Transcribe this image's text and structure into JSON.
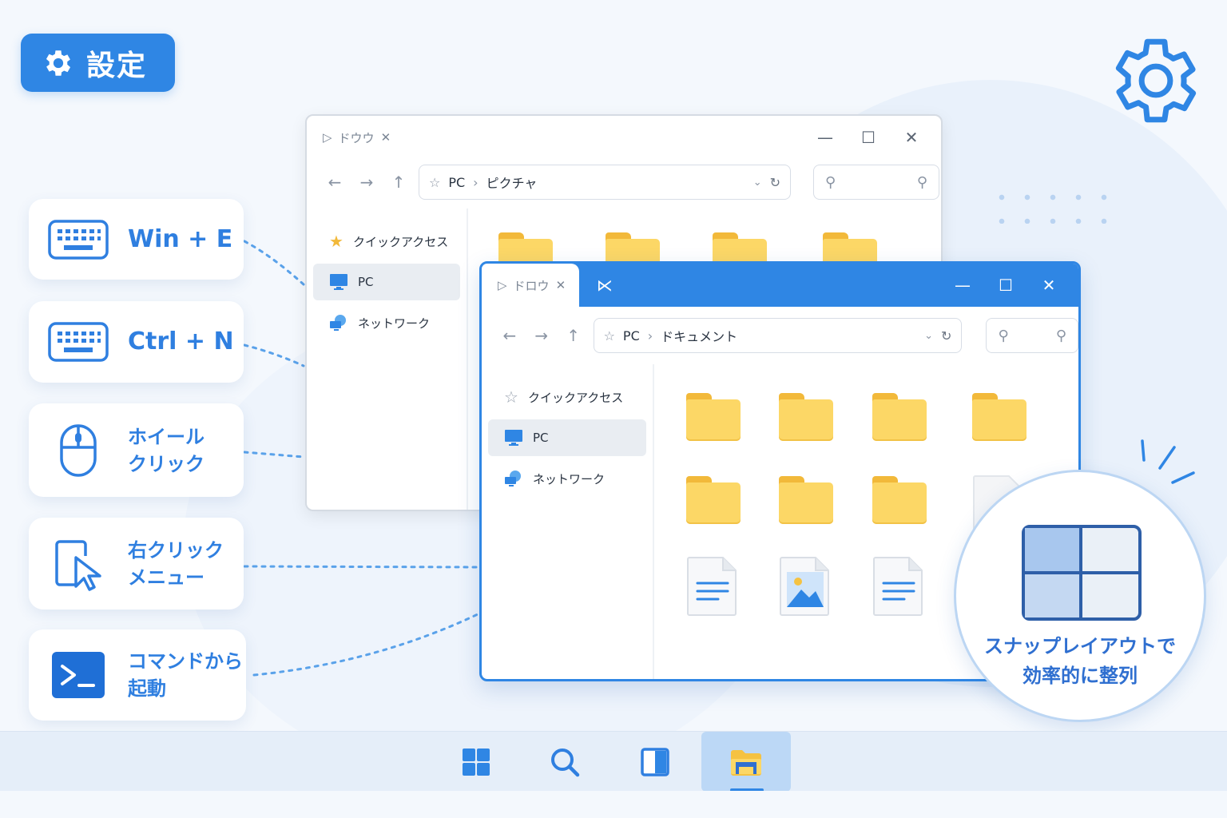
{
  "settings_badge": {
    "label": "設定"
  },
  "shortcuts": [
    {
      "id": "win-e",
      "label": "Win + E",
      "icon": "keyboard-icon"
    },
    {
      "id": "ctrl-n",
      "label": "Ctrl + N",
      "icon": "keyboard-icon"
    },
    {
      "id": "wheel",
      "label": "ホイール\nクリック",
      "icon": "mouse-icon"
    },
    {
      "id": "right-click",
      "label": "右クリック\nメニュー",
      "icon": "cursor-icon"
    },
    {
      "id": "command",
      "label": "コマンドから\n起動",
      "icon": "terminal-icon"
    }
  ],
  "back_window": {
    "tab_title": "ドウウ",
    "breadcrumb": [
      "PC",
      "ピクチャ"
    ],
    "sidebar": [
      "クイックアクセス",
      "PC",
      "ネットワーク"
    ],
    "selected_index": 1
  },
  "front_window": {
    "tab_title": "ドロウ",
    "breadcrumb": [
      "PC",
      "ドキュメント"
    ],
    "sidebar": [
      "クイックアクセス",
      "PC",
      "ネットワーク"
    ],
    "selected_index": 1
  },
  "controls": {
    "minimize": "—",
    "maximize": "☐",
    "close": "✕"
  },
  "snap": {
    "text": "スナップレイアウトで\n効率的に整列"
  },
  "taskbar": [
    "start-icon",
    "search-icon",
    "snap-window-icon",
    "file-explorer-icon"
  ],
  "colors": {
    "accent": "#2f86e4",
    "folder": "#fcd766",
    "label": "#2f7fe0"
  }
}
